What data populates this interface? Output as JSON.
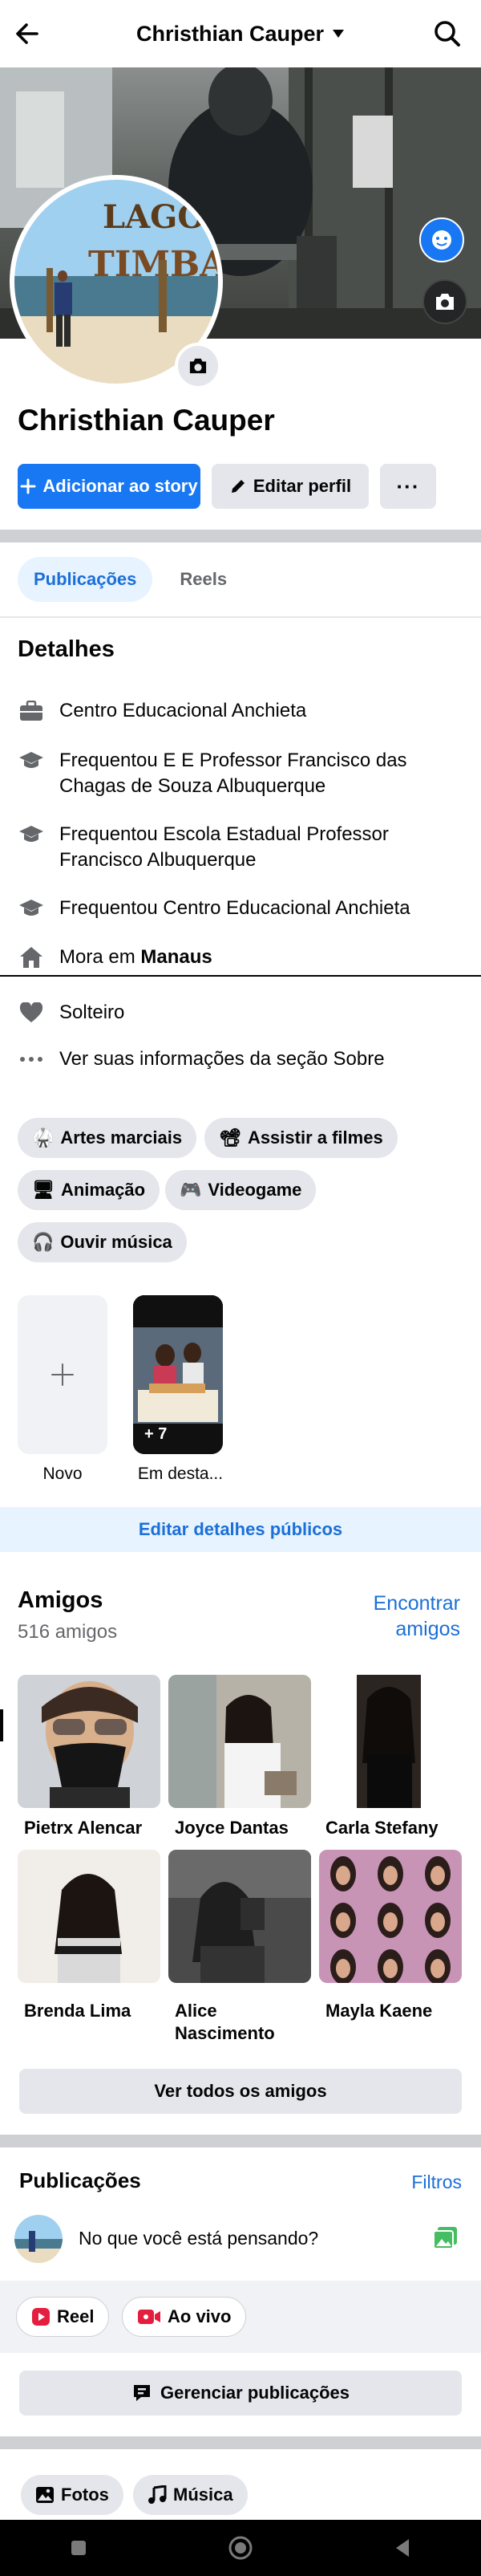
{
  "topbar": {
    "title": "Christhian Cauper"
  },
  "profile": {
    "name": "Christhian Cauper"
  },
  "actions": {
    "add_story": "Adicionar ao story",
    "edit_profile": "Editar perfil",
    "more": "···"
  },
  "tabs": [
    "Publicações",
    "Reels"
  ],
  "details": {
    "title": "Detalhes",
    "items": [
      {
        "icon": "briefcase-icon",
        "text": "Centro Educacional Anchieta"
      },
      {
        "icon": "graduation-cap-icon",
        "text": "Frequentou E E Professor Francisco das Chagas de Souza Albuquerque"
      },
      {
        "icon": "graduation-cap-icon",
        "text": "Frequentou Escola Estadual Professor Francisco Albuquerque"
      },
      {
        "icon": "graduation-cap-icon",
        "text": "Frequentou Centro Educacional Anchieta"
      },
      {
        "icon": "home-icon",
        "prefix": "Mora em ",
        "bold": "Manaus"
      },
      {
        "icon": "heart-icon",
        "text": "Solteiro"
      },
      {
        "icon": "ellipsis-icon",
        "text": "Ver suas informações da seção Sobre"
      }
    ]
  },
  "interests": [
    {
      "icon": "🥋",
      "label": "Artes marciais"
    },
    {
      "icon": "📽",
      "label": "Assistir a filmes"
    },
    {
      "icon": "🖥",
      "label": "Animação"
    },
    {
      "icon": "🎮",
      "label": "Videogame"
    },
    {
      "icon": "🎧",
      "label": "Ouvir música"
    }
  ],
  "highlights": {
    "new_label": "Novo",
    "featured_label": "Em desta...",
    "featured_count": "+ 7"
  },
  "edit_public_details": "Editar detalhes públicos",
  "friends": {
    "title": "Amigos",
    "count": "516 amigos",
    "find_line1": "Encontrar",
    "find_line2": "amigos",
    "list": [
      {
        "name": "Pietrx Alencar"
      },
      {
        "name": "Joyce Dantas"
      },
      {
        "name": "Carla Stefany"
      },
      {
        "name": "Brenda Lima"
      },
      {
        "name": "Alice Nascimento"
      },
      {
        "name": "Mayla Kaene"
      }
    ],
    "see_all": "Ver todos os amigos"
  },
  "posts": {
    "title": "Publicações",
    "filters": "Filtros",
    "composer_placeholder": "No que você está pensando?",
    "reel": "Reel",
    "live": "Ao vivo",
    "manage": "Gerenciar publicações"
  },
  "bottom_chips": {
    "photos": "Fotos",
    "music": "Música"
  },
  "colors": {
    "accent": "#1877f2",
    "live_red": "#e41e3f",
    "photo_green": "#45bd62"
  }
}
